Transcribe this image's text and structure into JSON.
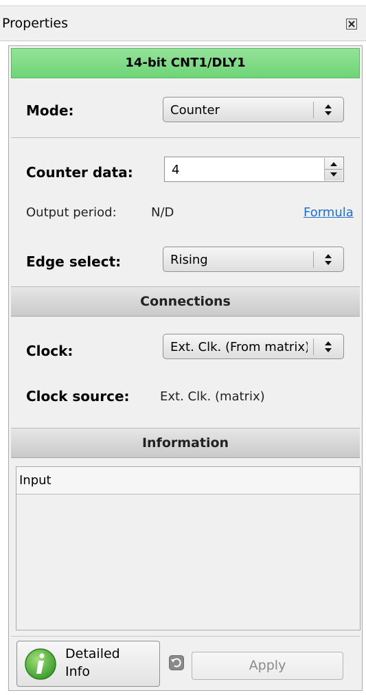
{
  "window": {
    "title": "Properties"
  },
  "block": {
    "header": "14-bit CNT1/DLY1"
  },
  "mode": {
    "label": "Mode:",
    "value": "Counter"
  },
  "counter_data": {
    "label": "Counter data:",
    "value": "4"
  },
  "output_period": {
    "label": "Output period:",
    "value": "N/D",
    "link": "Formula"
  },
  "edge_select": {
    "label": "Edge select:",
    "value": "Rising"
  },
  "connections": {
    "header": "Connections",
    "clock_label": "Clock:",
    "clock_value": "Ext. Clk. (From matrix)",
    "clock_source_label": "Clock source:",
    "clock_source_value": "Ext. Clk. (matrix)"
  },
  "information": {
    "header": "Information",
    "column": "Input"
  },
  "buttons": {
    "detailed_info_line1": "Detailed",
    "detailed_info_line2": "Info",
    "apply": "Apply"
  },
  "colors": {
    "header_green": "#7ad880",
    "link_blue": "#1a6fd8"
  }
}
